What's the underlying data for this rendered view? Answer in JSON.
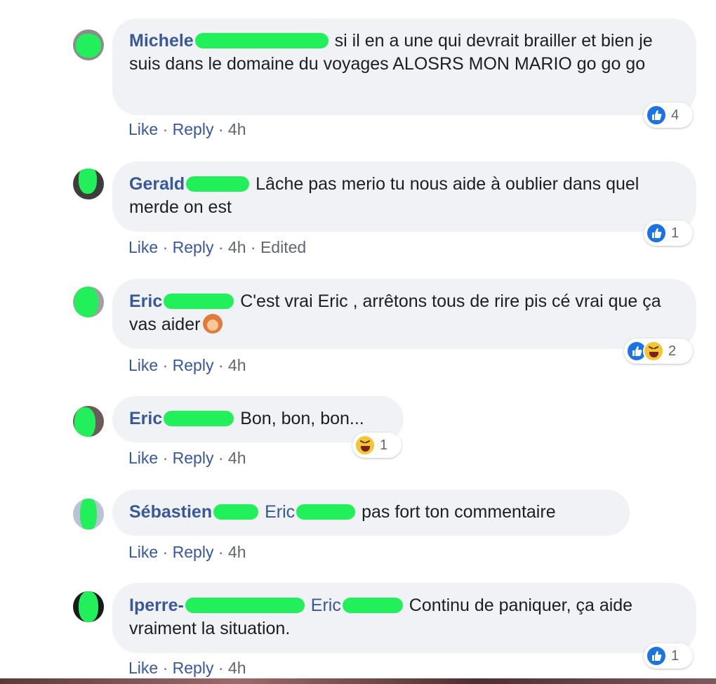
{
  "comments": [
    {
      "name": "Michele",
      "text": "si il en a une qui devrait brailler et bien je suis dans le domaine du voyages ALOSRS MON MARIO go go go",
      "like": "Like",
      "reply": "Reply",
      "time": "4h",
      "reaction_count": "4"
    },
    {
      "name": "Gerald",
      "text": "Lâche pas merio tu nous aide à oublier dans quel merde on est",
      "like": "Like",
      "reply": "Reply",
      "time": "4h",
      "edited": "Edited",
      "reaction_count": "1"
    },
    {
      "name": "Eric",
      "text": "C'est vrai Eric , arrêtons tous de rire pis cé vrai que ça vas aider",
      "like": "Like",
      "reply": "Reply",
      "time": "4h",
      "reaction_count": "2"
    },
    {
      "name": "Eric",
      "text": "Bon, bon, bon...",
      "like": "Like",
      "reply": "Reply",
      "time": "4h",
      "reaction_count": "1"
    },
    {
      "name": "Sébastien",
      "mention": "Eric",
      "text": "pas fort ton commentaire",
      "like": "Like",
      "reply": "Reply",
      "time": "4h"
    },
    {
      "name": "Iperre-",
      "mention": "Eric",
      "text": "Continu de paniquer, ça aide vraiment la situation.",
      "like": "Like",
      "reply": "Reply",
      "time": "4h",
      "reaction_count": "1"
    }
  ],
  "colors": {
    "name": "#385898",
    "bubble": "#f0f2f5",
    "meta": "#606770",
    "redaction": "#22f05a"
  },
  "icons": {
    "like": "thumbs-up-icon",
    "haha": "laughing-face-icon",
    "facepalm": "facepalm-emoji-icon"
  },
  "separator": "·"
}
